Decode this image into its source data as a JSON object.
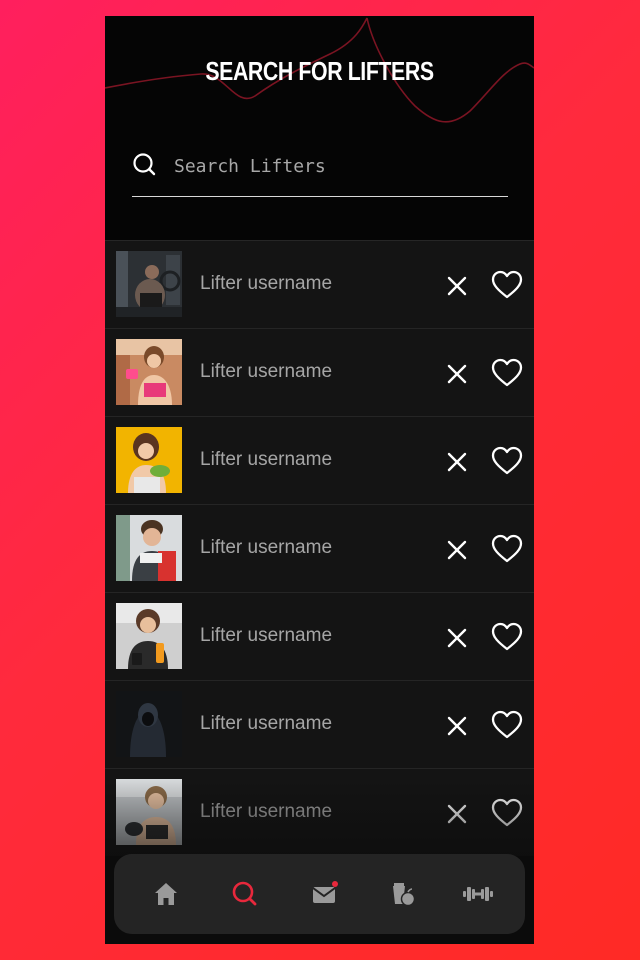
{
  "header": {
    "title": "SEARCH FOR LIFTERS"
  },
  "search": {
    "placeholder": "Search Lifters",
    "value": ""
  },
  "lifters": [
    {
      "username": "Lifter username"
    },
    {
      "username": "Lifter username"
    },
    {
      "username": "Lifter username"
    },
    {
      "username": "Lifter username"
    },
    {
      "username": "Lifter username"
    },
    {
      "username": "Lifter username"
    },
    {
      "username": "Lifter username"
    }
  ],
  "row_icons": {
    "dismiss": "close-icon",
    "like": "heart-icon"
  },
  "nav": {
    "items": [
      {
        "icon": "home-icon",
        "active": false
      },
      {
        "icon": "search-icon",
        "active": true
      },
      {
        "icon": "mail-icon",
        "active": false,
        "notification_dot": true
      },
      {
        "icon": "nutrition-icon",
        "active": false
      },
      {
        "icon": "dumbbell-icon",
        "active": false
      }
    ]
  },
  "colors": {
    "background_start": "#ff1f5e",
    "background_end": "#ff2a25",
    "accent": "#e8283c",
    "surface": "#141414",
    "nav_bar": "#242424",
    "text_muted": "#a6a6a6"
  }
}
